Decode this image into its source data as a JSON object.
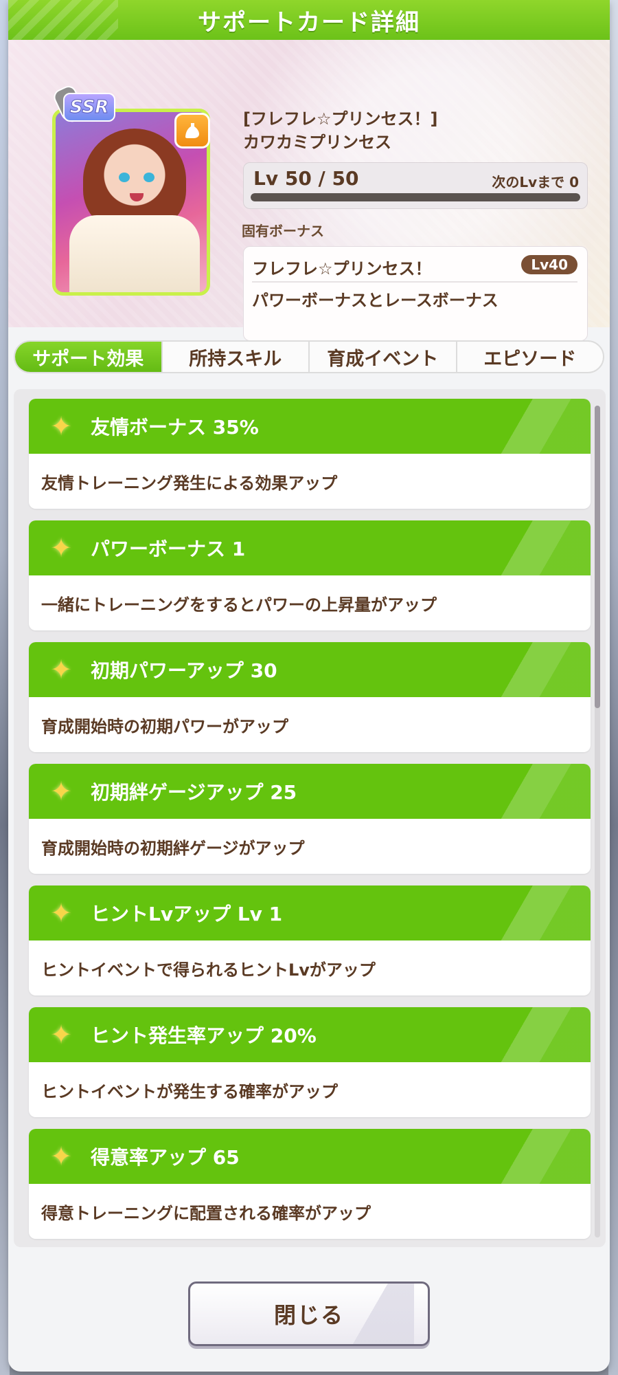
{
  "window": {
    "title": "サポートカード詳細"
  },
  "card": {
    "rarity": "SSR",
    "type_icon": "power-muscle-icon",
    "title": "[フレフレ☆プリンセス！]",
    "name": "カワカミプリンセス",
    "level_text": "Lv 50 / 50",
    "next_lv_text": "次のLvまで 0",
    "level_progress": 1.0
  },
  "unique_bonus": {
    "label": "固有ボーナス",
    "name": "フレフレ☆プリンセス！",
    "lv_badge": "Lv40",
    "description": "パワーボーナスとレースボーナス"
  },
  "tabs": [
    {
      "label": "サポート効果",
      "active": true
    },
    {
      "label": "所持スキル",
      "active": false
    },
    {
      "label": "育成イベント",
      "active": false
    },
    {
      "label": "エピソード",
      "active": false
    }
  ],
  "effects": [
    {
      "name": "友情ボーナス 35%",
      "description": "友情トレーニング発生による効果アップ"
    },
    {
      "name": "パワーボーナス 1",
      "description": "一緒にトレーニングをするとパワーの上昇量がアップ"
    },
    {
      "name": "初期パワーアップ 30",
      "description": "育成開始時の初期パワーがアップ"
    },
    {
      "name": "初期絆ゲージアップ 25",
      "description": "育成開始時の初期絆ゲージがアップ"
    },
    {
      "name": "ヒントLvアップ Lv 1",
      "description": "ヒントイベントで得られるヒントLvがアップ"
    },
    {
      "name": "ヒント発生率アップ 20%",
      "description": "ヒントイベントが発生する確率がアップ"
    },
    {
      "name": "得意率アップ 65",
      "description": "得意トレーニングに配置される確率がアップ"
    }
  ],
  "footer": {
    "close_label": "閉じる"
  },
  "colors": {
    "accent_green": "#64c30e",
    "text_brown": "#5a3a24",
    "lv_badge_bg": "#7a4f34"
  }
}
